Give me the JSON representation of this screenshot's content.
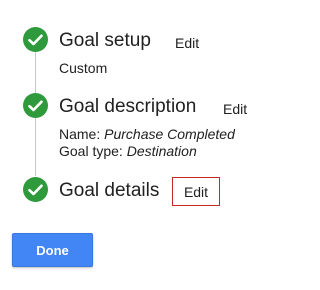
{
  "steps": [
    {
      "title": "Goal setup",
      "edit_label": "Edit",
      "subtitle": "Custom",
      "icon": "check-circle-icon"
    },
    {
      "title": "Goal description",
      "edit_label": "Edit",
      "details": [
        {
          "label": "Name: ",
          "value": "Purchase Completed"
        },
        {
          "label": "Goal type: ",
          "value": "Destination"
        }
      ],
      "icon": "check-circle-icon"
    },
    {
      "title": "Goal details",
      "edit_label": "Edit",
      "icon": "check-circle-icon"
    }
  ],
  "done_label": "Done",
  "colors": {
    "check_green": "#2e9a3c",
    "primary_blue": "#4285f4",
    "highlight_red": "#c62828"
  }
}
